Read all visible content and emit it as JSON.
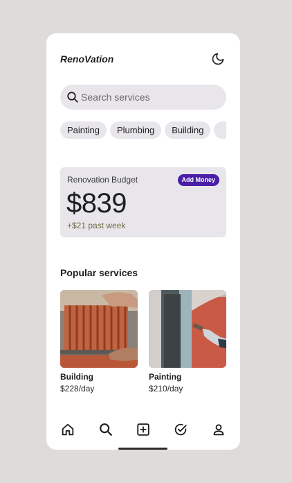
{
  "header": {
    "title": "RenoVation",
    "theme_icon": "moon-icon"
  },
  "search": {
    "placeholder": "Search services",
    "icon": "search-icon"
  },
  "categories": [
    "Painting",
    "Plumbing",
    "Building",
    ""
  ],
  "budget": {
    "label": "Renovation Budget",
    "button_label": "Add Money",
    "amount": "$839",
    "change": "+$21 past week"
  },
  "popular": {
    "title": "Popular services",
    "items": [
      {
        "name": "Building",
        "price": "$228/day"
      },
      {
        "name": "Painting",
        "price": "$210/day"
      }
    ]
  },
  "nav": {
    "items": [
      "home-icon",
      "search-icon",
      "add-square-icon",
      "check-circle-icon",
      "profile-icon"
    ]
  },
  "colors": {
    "background": "#dddcda",
    "surface": "#e8e6eb",
    "accent": "#4a1fa8",
    "change_text": "#6b6a3e"
  }
}
